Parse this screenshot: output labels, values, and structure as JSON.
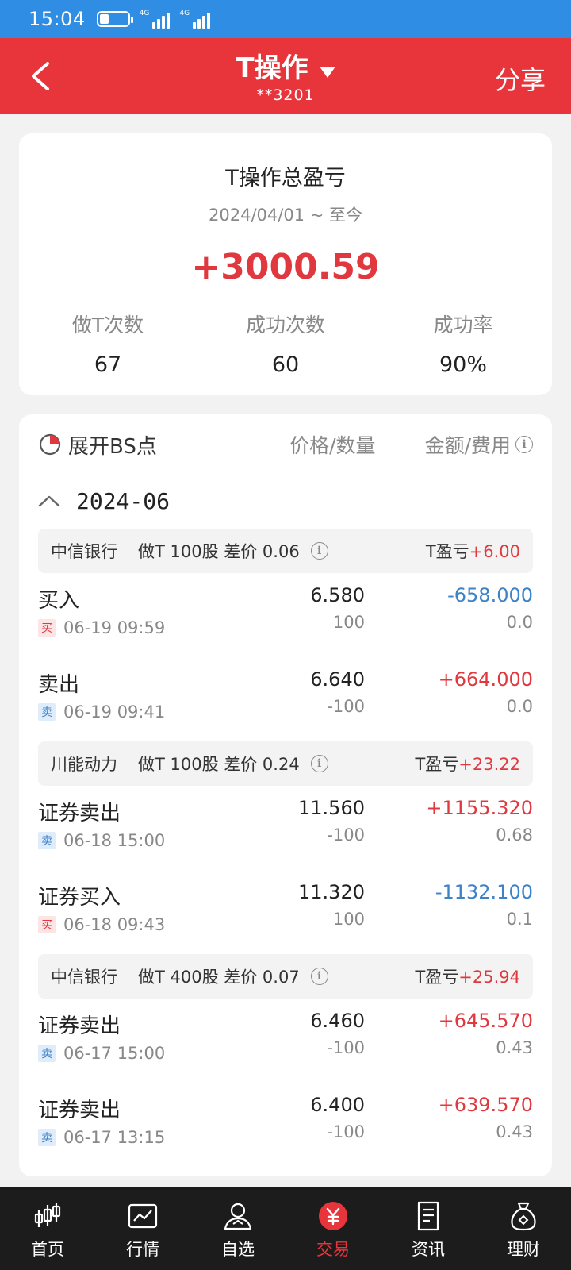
{
  "status_bar": {
    "time": "15:04",
    "net1": "4G",
    "net2": "4G"
  },
  "header": {
    "title": "T操作",
    "account": "**3201",
    "share_label": "分享"
  },
  "summary": {
    "title": "T操作总盈亏",
    "date_range": "2024/04/01 ~ 至今",
    "total": "+3000.59",
    "stats": [
      {
        "label": "做T次数",
        "value": "67"
      },
      {
        "label": "成功次数",
        "value": "60"
      },
      {
        "label": "成功率",
        "value": "90%"
      }
    ]
  },
  "detail": {
    "expand_label": "展开BS点",
    "col_price": "价格/数量",
    "col_amount": "金额/费用",
    "month": "2024-06",
    "groups": [
      {
        "stock": "中信银行",
        "desc": "做T 100股 差价 0.06",
        "pl_label": "T盈亏",
        "pl_value": "+6.00",
        "trades": [
          {
            "type": "买入",
            "badge": "买",
            "time": "06-19 09:59",
            "price": "6.580",
            "qty": "100",
            "amount": "-658.000",
            "fee": "0.0"
          },
          {
            "type": "卖出",
            "badge": "卖",
            "time": "06-19 09:41",
            "price": "6.640",
            "qty": "-100",
            "amount": "+664.000",
            "fee": "0.0"
          }
        ]
      },
      {
        "stock": "川能动力",
        "desc": "做T 100股 差价 0.24",
        "pl_label": "T盈亏",
        "pl_value": "+23.22",
        "trades": [
          {
            "type": "证券卖出",
            "badge": "卖",
            "time": "06-18 15:00",
            "price": "11.560",
            "qty": "-100",
            "amount": "+1155.320",
            "fee": "0.68"
          },
          {
            "type": "证券买入",
            "badge": "买",
            "time": "06-18 09:43",
            "price": "11.320",
            "qty": "100",
            "amount": "-1132.100",
            "fee": "0.1"
          }
        ]
      },
      {
        "stock": "中信银行",
        "desc": "做T 400股 差价 0.07",
        "pl_label": "T盈亏",
        "pl_value": "+25.94",
        "trades": [
          {
            "type": "证券卖出",
            "badge": "卖",
            "time": "06-17 15:00",
            "price": "6.460",
            "qty": "-100",
            "amount": "+645.570",
            "fee": "0.43"
          },
          {
            "type": "证券卖出",
            "badge": "卖",
            "time": "06-17 13:15",
            "price": "6.400",
            "qty": "-100",
            "amount": "+639.570",
            "fee": "0.43"
          }
        ]
      }
    ]
  },
  "bottom_nav": [
    {
      "label": "首页",
      "icon": "candlestick-icon"
    },
    {
      "label": "行情",
      "icon": "chart-icon"
    },
    {
      "label": "自选",
      "icon": "person-icon"
    },
    {
      "label": "交易",
      "icon": "yen-icon",
      "active": true
    },
    {
      "label": "资讯",
      "icon": "document-icon"
    },
    {
      "label": "理财",
      "icon": "money-bag-icon"
    }
  ],
  "colors": {
    "brand_red": "#e8353b",
    "status_blue": "#2f8de4",
    "gain": "#e0383e",
    "loss": "#3b82c9"
  }
}
